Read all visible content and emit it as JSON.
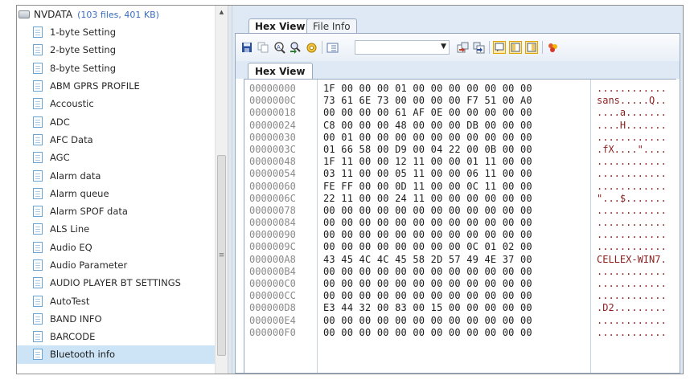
{
  "tree": {
    "root_label": "NVDATA",
    "root_meta": "(103 files, 401 KB)",
    "items": [
      "1-byte Setting",
      "2-byte Setting",
      "8-byte Setting",
      "ABM GPRS PROFILE",
      "Accoustic",
      "ADC",
      "AFC Data",
      "AGC",
      "Alarm data",
      "Alarm queue",
      "Alarm SPOF data",
      "ALS Line",
      "Audio EQ",
      "Audio Parameter",
      "AUDIO PLAYER BT SETTINGS",
      "AutoTest",
      "BAND INFO",
      "BARCODE",
      "Bluetooth info"
    ],
    "selected_index": 18
  },
  "tabs": [
    "Hex View",
    "File Info"
  ],
  "subtab": "Hex View",
  "toolbar_icons": [
    "save-icon",
    "copy-icon",
    "find-icon",
    "find-next-icon",
    "settings-icon",
    "view-icon",
    "import-icon",
    "export-icon",
    "text-mode-icon",
    "hex-mode-icon",
    "split-mode-icon",
    "clear-icon"
  ],
  "hex": {
    "rows": [
      {
        "addr": "00000000",
        "bytes": "1F 00 00 00 01 00 00 00 00 00 00 00",
        "ascii": "............"
      },
      {
        "addr": "0000000C",
        "bytes": "73 61 6E 73 00 00 00 00 F7 51 00 A0",
        "ascii": "sans.....Q.."
      },
      {
        "addr": "00000018",
        "bytes": "00 00 00 00 61 AF 0E 00 00 00 00 00",
        "ascii": "....a......."
      },
      {
        "addr": "00000024",
        "bytes": "C8 00 00 00 48 00 00 00 DB 00 00 00",
        "ascii": "....H......."
      },
      {
        "addr": "00000030",
        "bytes": "00 01 00 00 00 00 00 00 00 00 00 00",
        "ascii": "............"
      },
      {
        "addr": "0000003C",
        "bytes": "01 66 58 00 D9 00 04 22 00 0B 00 00",
        "ascii": ".fX....\"...."
      },
      {
        "addr": "00000048",
        "bytes": "1F 11 00 00 12 11 00 00 01 11 00 00",
        "ascii": "............"
      },
      {
        "addr": "00000054",
        "bytes": "03 11 00 00 05 11 00 00 06 11 00 00",
        "ascii": "............"
      },
      {
        "addr": "00000060",
        "bytes": "FE FF 00 00 0D 11 00 00 0C 11 00 00",
        "ascii": "............"
      },
      {
        "addr": "0000006C",
        "bytes": "22 11 00 00 24 11 00 00 00 00 00 00",
        "ascii": "\"...$......."
      },
      {
        "addr": "00000078",
        "bytes": "00 00 00 00 00 00 00 00 00 00 00 00",
        "ascii": "............"
      },
      {
        "addr": "00000084",
        "bytes": "00 00 00 00 00 00 00 00 00 00 00 00",
        "ascii": "............"
      },
      {
        "addr": "00000090",
        "bytes": "00 00 00 00 00 00 00 00 00 00 00 00",
        "ascii": "............"
      },
      {
        "addr": "0000009C",
        "bytes": "00 00 00 00 00 00 00 00 0C 01 02 00",
        "ascii": "............"
      },
      {
        "addr": "000000A8",
        "bytes": "43 45 4C 4C 45 58 2D 57 49 4E 37 00",
        "ascii": "CELLEX-WIN7."
      },
      {
        "addr": "000000B4",
        "bytes": "00 00 00 00 00 00 00 00 00 00 00 00",
        "ascii": "............"
      },
      {
        "addr": "000000C0",
        "bytes": "00 00 00 00 00 00 00 00 00 00 00 00",
        "ascii": "............"
      },
      {
        "addr": "000000CC",
        "bytes": "00 00 00 00 00 00 00 00 00 00 00 00",
        "ascii": "............"
      },
      {
        "addr": "000000D8",
        "bytes": "E3 44 32 00 83 00 15 00 00 00 00 00",
        "ascii": ".D2........."
      },
      {
        "addr": "000000E4",
        "bytes": "00 00 00 00 00 00 00 00 00 00 00 00",
        "ascii": "............"
      },
      {
        "addr": "000000F0",
        "bytes": "00 00 00 00 00 00 00 00 00 00 00 00",
        "ascii": "............"
      }
    ]
  }
}
